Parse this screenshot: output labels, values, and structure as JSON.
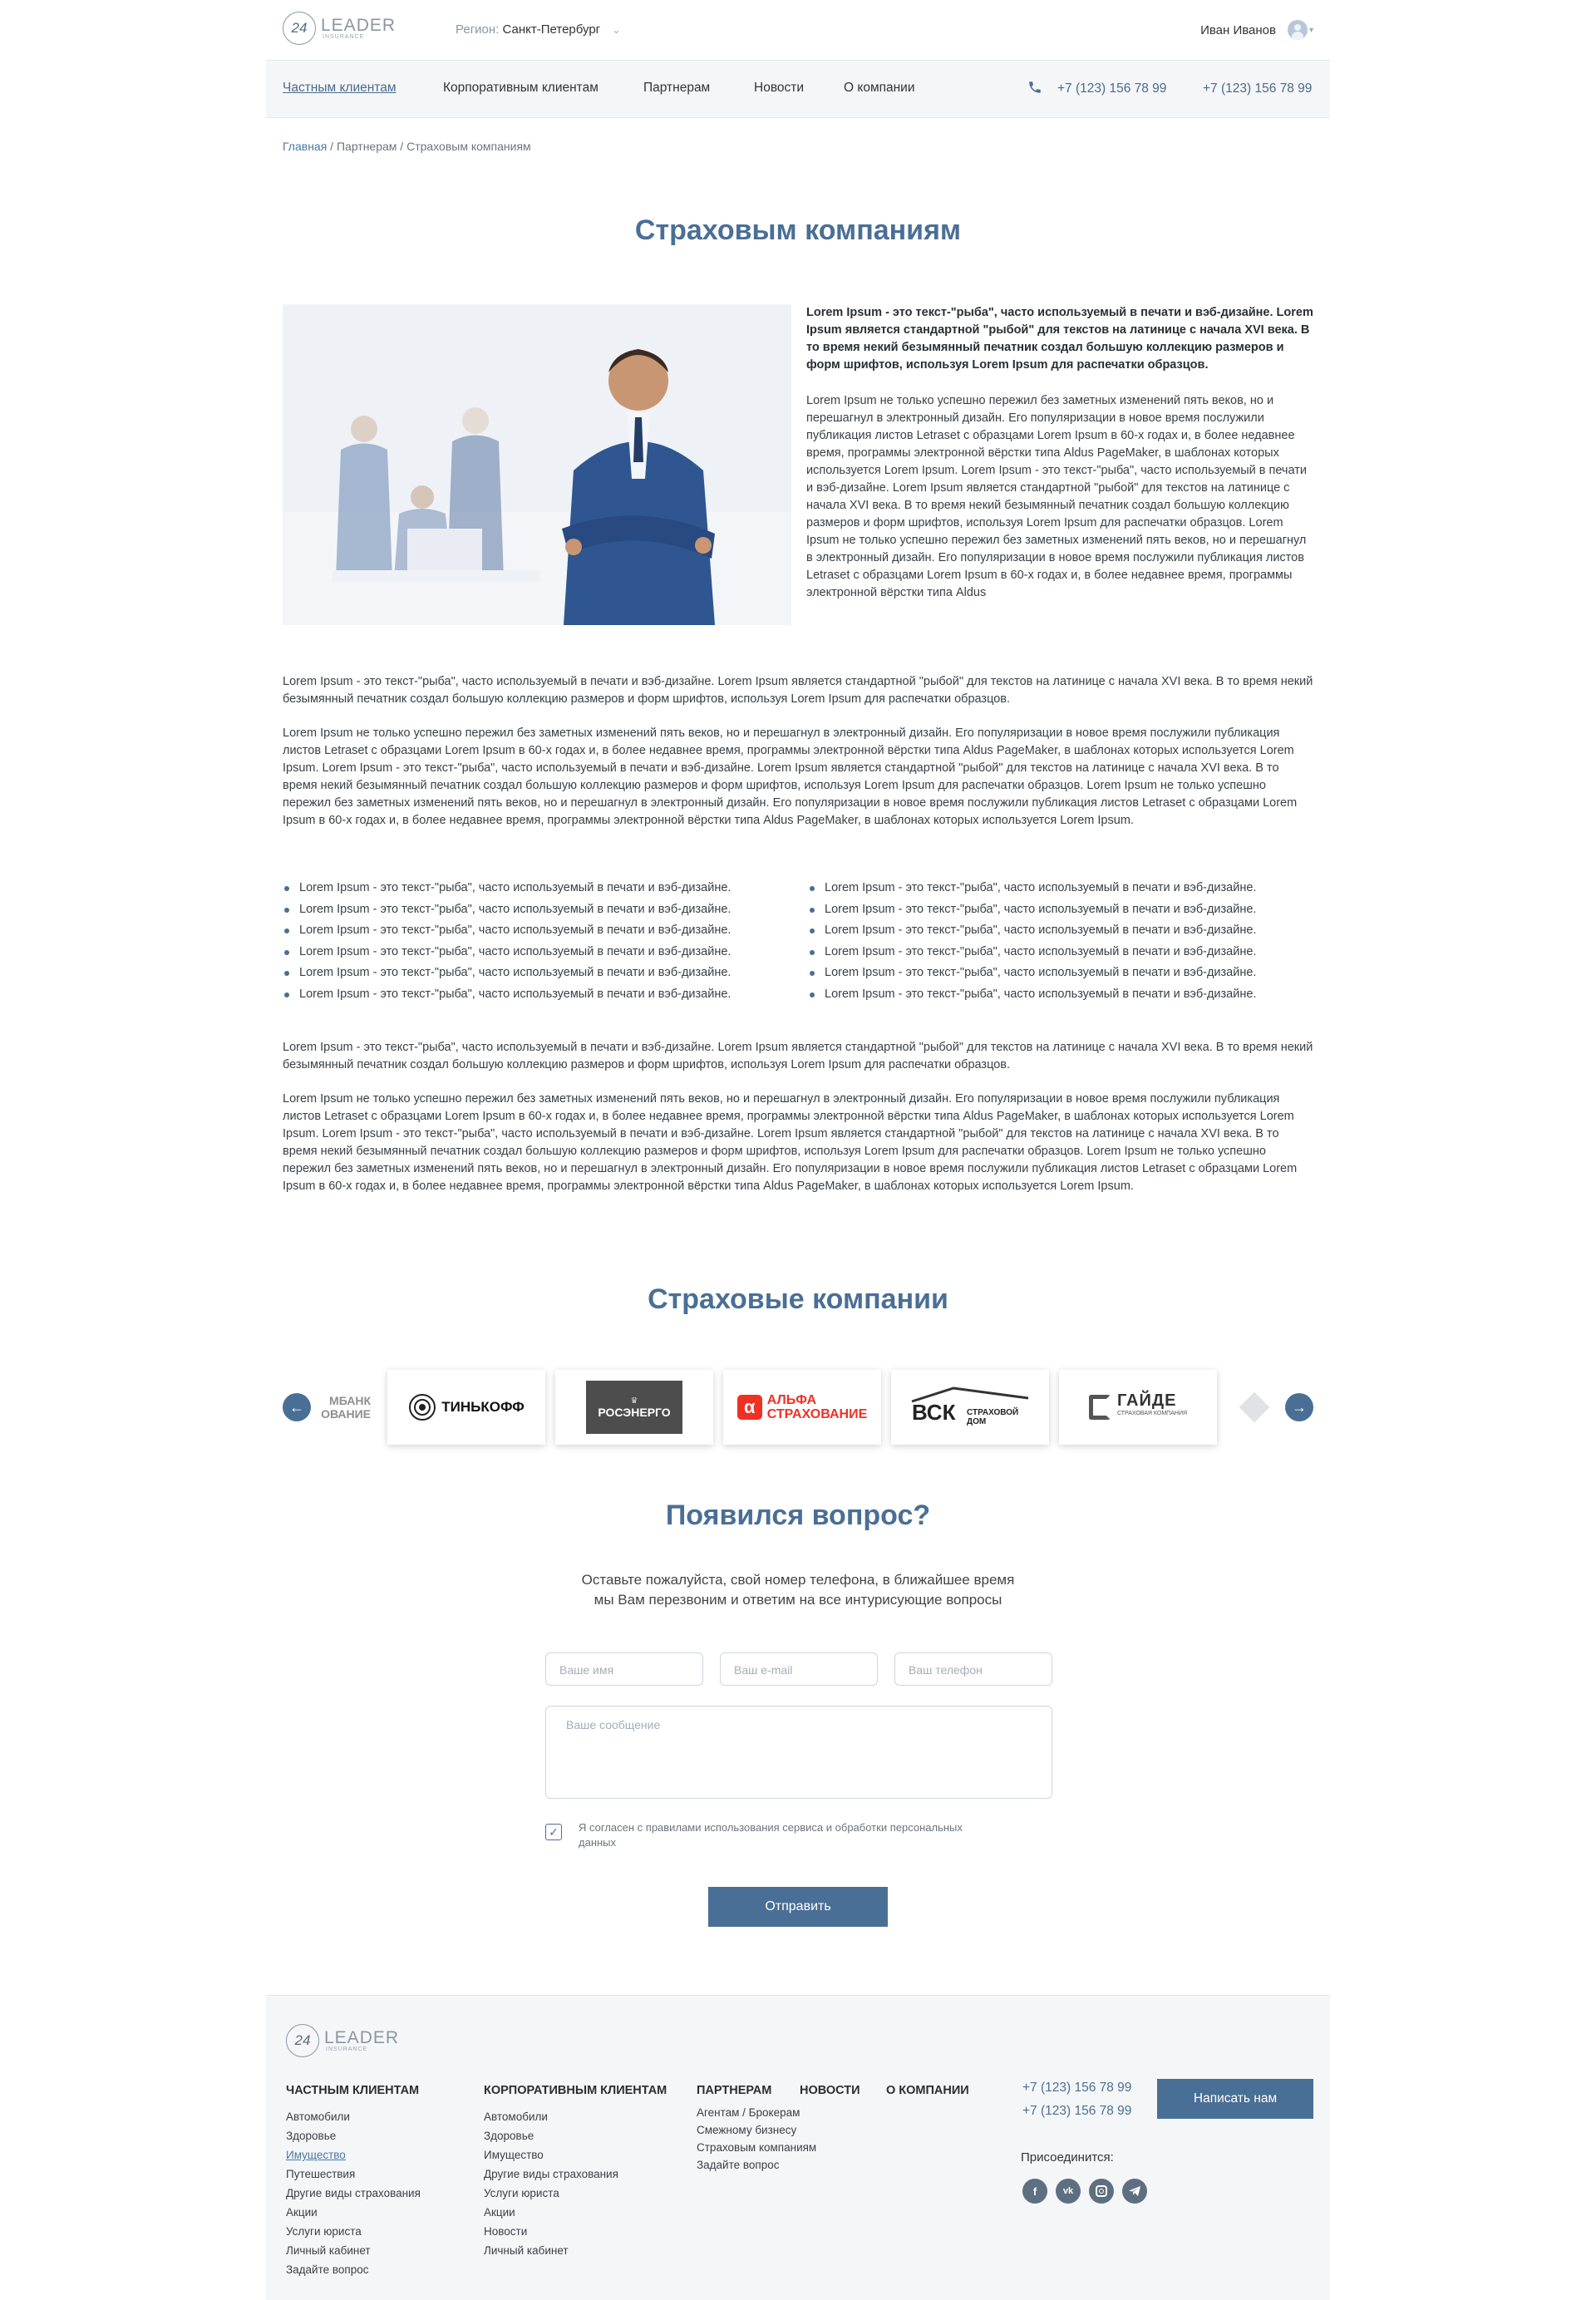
{
  "header": {
    "logo_number": "24",
    "logo_main": "LEADER",
    "logo_sub": "INSURANCE",
    "region_label": "Регион:",
    "region_city": "Санкт-Петербург",
    "user_name": "Иван Иванов"
  },
  "nav": {
    "items": [
      "Частным клиентам",
      "Корпоративным клиентам",
      "Партнерам",
      "Новости",
      "О компании"
    ],
    "phones": [
      "+7 (123) 156 78 99",
      "+7 (123) 156 78 99"
    ]
  },
  "breadcrumb": {
    "home": "Главная",
    "rest": " / Партнерам / Страховым компаниям"
  },
  "page_title": "Страховым компаниям",
  "intro": {
    "bold": "Lorem Ipsum - это текст-\"рыба\", часто используемый в печати и вэб-дизайне. Lorem Ipsum является стандартной \"рыбой\" для текстов на латинице с начала XVI века. В то время некий безымянный печатник создал большую коллекцию размеров и форм шрифтов, используя Lorem Ipsum для распечатки образцов.",
    "text": "Lorem Ipsum не только успешно пережил без заметных изменений пять веков, но и перешагнул в электронный дизайн. Его популяризации в новое время послужили публикация листов Letraset с образцами Lorem Ipsum в 60-х годах и, в более недавнее время, программы электронной вёрстки типа Aldus PageMaker, в шаблонах которых используется Lorem Ipsum. Lorem Ipsum - это текст-\"рыба\", часто используемый в печати и вэб-дизайне. Lorem Ipsum является стандартной \"рыбой\" для текстов на латинице с начала XVI века. В то время некий безымянный печатник создал большую коллекцию размеров и форм шрифтов, используя Lorem Ipsum для распечатки образцов. Lorem Ipsum не только успешно пережил без заметных изменений пять веков, но и перешагнул в электронный дизайн. Его популяризации в новое время послужили публикация листов Letraset с образцами Lorem Ipsum в 60-х годах и, в более недавнее время, программы электронной вёрстки типа Aldus"
  },
  "body": {
    "p1": "Lorem Ipsum - это текст-\"рыба\", часто используемый в печати и вэб-дизайне. Lorem Ipsum является стандартной \"рыбой\" для текстов на латинице с начала XVI века. В то время некий безымянный печатник создал большую коллекцию размеров и форм шрифтов, используя Lorem Ipsum для распечатки образцов.",
    "p2": "Lorem Ipsum не только успешно пережил без заметных изменений пять веков, но и перешагнул в электронный дизайн. Его популяризации в новое время послужили публикация листов Letraset с образцами Lorem Ipsum в 60-х годах и, в более недавнее время, программы электронной вёрстки типа Aldus PageMaker, в шаблонах которых используется Lorem Ipsum. Lorem Ipsum - это текст-\"рыба\", часто используемый в печати и вэб-дизайне. Lorem Ipsum является стандартной \"рыбой\" для текстов на латинице с начала XVI века. В то время некий безымянный печатник создал большую коллекцию размеров и форм шрифтов, используя Lorem Ipsum для распечатки образцов. Lorem Ipsum не только успешно пережил без заметных изменений пять веков, но и перешагнул в электронный дизайн. Его популяризации в новое время послужили публикация листов Letraset с образцами Lorem Ipsum в 60-х годах и, в более недавнее время, программы электронной вёрстки типа Aldus PageMaker, в шаблонах которых используется Lorem Ipsum.",
    "bullets": [
      "Lorem Ipsum - это текст-\"рыба\", часто используемый в печати и вэб-дизайне.",
      "Lorem Ipsum - это текст-\"рыба\", часто используемый в печати и вэб-дизайне.",
      "Lorem Ipsum - это текст-\"рыба\", часто используемый в печати и вэб-дизайне.",
      "Lorem Ipsum - это текст-\"рыба\", часто используемый в печати и вэб-дизайне.",
      "Lorem Ipsum - это текст-\"рыба\", часто используемый в печати и вэб-дизайне.",
      "Lorem Ipsum - это текст-\"рыба\", часто используемый в печати и вэб-дизайне.",
      "Lorem Ipsum - это текст-\"рыба\", часто используемый в печати и вэб-дизайне.",
      "Lorem Ipsum - это текст-\"рыба\", часто используемый в печати и вэб-дизайне.",
      "Lorem Ipsum - это текст-\"рыба\", часто используемый в печати и вэб-дизайне.",
      "Lorem Ipsum - это текст-\"рыба\", часто используемый в печати и вэб-дизайне.",
      "Lorem Ipsum - это текст-\"рыба\", часто используемый в печати и вэб-дизайне.",
      "Lorem Ipsum - это текст-\"рыба\", часто используемый в печати и вэб-дизайне."
    ],
    "p3": "Lorem Ipsum - это текст-\"рыба\", часто используемый в печати и вэб-дизайне. Lorem Ipsum является стандартной \"рыбой\" для текстов на латинице с начала XVI века. В то время некий безымянный печатник создал большую коллекцию размеров и форм шрифтов, используя Lorem Ipsum для распечатки образцов.",
    "p4": "Lorem Ipsum не только успешно пережил без заметных изменений пять веков, но и перешагнул в электронный дизайн. Его популяризации в новое время послужили публикация листов Letraset с образцами Lorem Ipsum в 60-х годах и, в более недавнее время, программы электронной вёрстки типа Aldus PageMaker, в шаблонах которых используется Lorem Ipsum. Lorem Ipsum - это текст-\"рыба\", часто используемый в печати и вэб-дизайне. Lorem Ipsum является стандартной \"рыбой\" для текстов на латинице с начала XVI века. В то время некий безымянный печатник создал большую коллекцию размеров и форм шрифтов, используя Lorem Ipsum для распечатки образцов. Lorem Ipsum не только успешно пережил без заметных изменений пять веков, но и перешагнул в электронный дизайн. Его популяризации в новое время послужили публикация листов Letraset с образцами Lorem Ipsum в 60-х годах и, в более недавнее время, программы электронной вёрстки типа Aldus PageMaker, в шаблонах которых используется Lorem Ipsum."
  },
  "companies": {
    "title": "Страховые компании",
    "logos": {
      "left_partial": "МБАНК",
      "left_partial_sub": "ОВАНИЕ",
      "tinkoff": "ТИНЬКОФФ",
      "rosenergo": "РОСЭНЕРГО",
      "alfa_top": "АЛЬФА",
      "alfa_bottom": "СТРАХОВАНИЕ",
      "vsk": "ВСК",
      "vsk_sub": "СТРАХОВОЙ ДОМ",
      "gaide": "ГАЙДЕ",
      "gaide_sub": "СТРАХОВАЯ КОМПАНИЯ"
    }
  },
  "question": {
    "title": "Появился вопрос?",
    "subtitle_line1": "Оставьте пожалуйста, свой номер телефона, в ближайшее время",
    "subtitle_line2": "мы Вам перезвоним и ответим на все интурисующие вопросы",
    "name_placeholder": "Ваше имя",
    "email_placeholder": "Ваш e-mail",
    "phone_placeholder": "Ваш телефон",
    "message_placeholder": "Ваше сообщение",
    "consent": "Я согласен с правилами использования сервиса и обработки персональных данных",
    "submit": "Отправить"
  },
  "footer": {
    "col1_title": "ЧАСТНЫМ КЛИЕНТАМ",
    "col1_items": [
      "Автомобили",
      "Здоровье",
      "Имущество",
      "Путешествия",
      "Другие виды страхования",
      "Акции",
      "Услуги юриста",
      "Личный кабинет",
      "Задайте вопрос"
    ],
    "col2_title": "КОРПОРАТИВНЫМ КЛИЕНТАМ",
    "col2_items": [
      "Автомобили",
      "Здоровье",
      "Имущество",
      "Другие виды страхования",
      "Услуги юриста",
      "Акции",
      "Новости",
      "Личный кабинет"
    ],
    "col3_title": "ПАРТНЕРАМ",
    "col3_items": [
      "Агентам / Брокерам",
      "Смежному бизнесу",
      "Страховым компаниям",
      "Задайте вопрос"
    ],
    "col4_title": "НОВОСТИ",
    "col5_title": "О КОМПАНИИ",
    "phones": [
      "+7 (123) 156 78 99",
      "+7 (123) 156 78 99"
    ],
    "write_button": "Написать нам",
    "join_label": "Присоединится:"
  },
  "colors": {
    "accent": "#4a6f96",
    "link": "#4a78a8",
    "nav_bg": "#f5f6f8",
    "alfa_red": "#ef3124"
  }
}
